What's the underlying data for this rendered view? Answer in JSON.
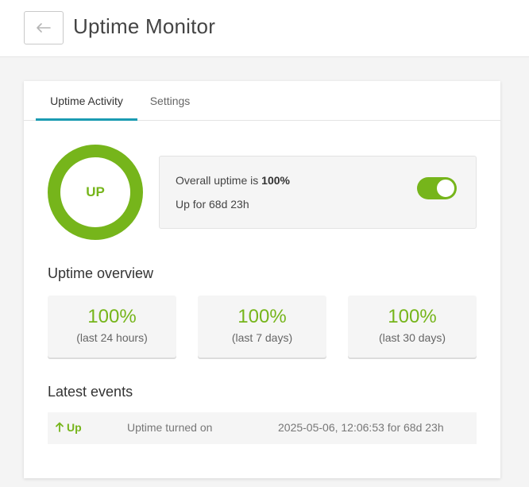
{
  "header": {
    "title": "Uptime Monitor",
    "back_icon": "arrow-left-icon"
  },
  "tabs": [
    {
      "label": "Uptime Activity",
      "active": true
    },
    {
      "label": "Settings",
      "active": false
    }
  ],
  "status": {
    "donut_label": "UP",
    "overall_prefix": "Overall uptime is ",
    "overall_value": "100%",
    "up_for": "Up for 68d 23h",
    "toggle_on": true
  },
  "overview": {
    "title": "Uptime overview",
    "stats": [
      {
        "value": "100%",
        "label": "(last 24 hours)"
      },
      {
        "value": "100%",
        "label": "(last 7 days)"
      },
      {
        "value": "100%",
        "label": "(last 30 days)"
      }
    ]
  },
  "events": {
    "title": "Latest events",
    "rows": [
      {
        "icon": "arrow-up-icon",
        "status": "Up",
        "description": "Uptime turned on",
        "time": "2025-05-06, 12:06:53 for 68d 23h"
      }
    ]
  },
  "colors": {
    "accent_green": "#76b51b",
    "tab_underline": "#1b9bb2"
  }
}
